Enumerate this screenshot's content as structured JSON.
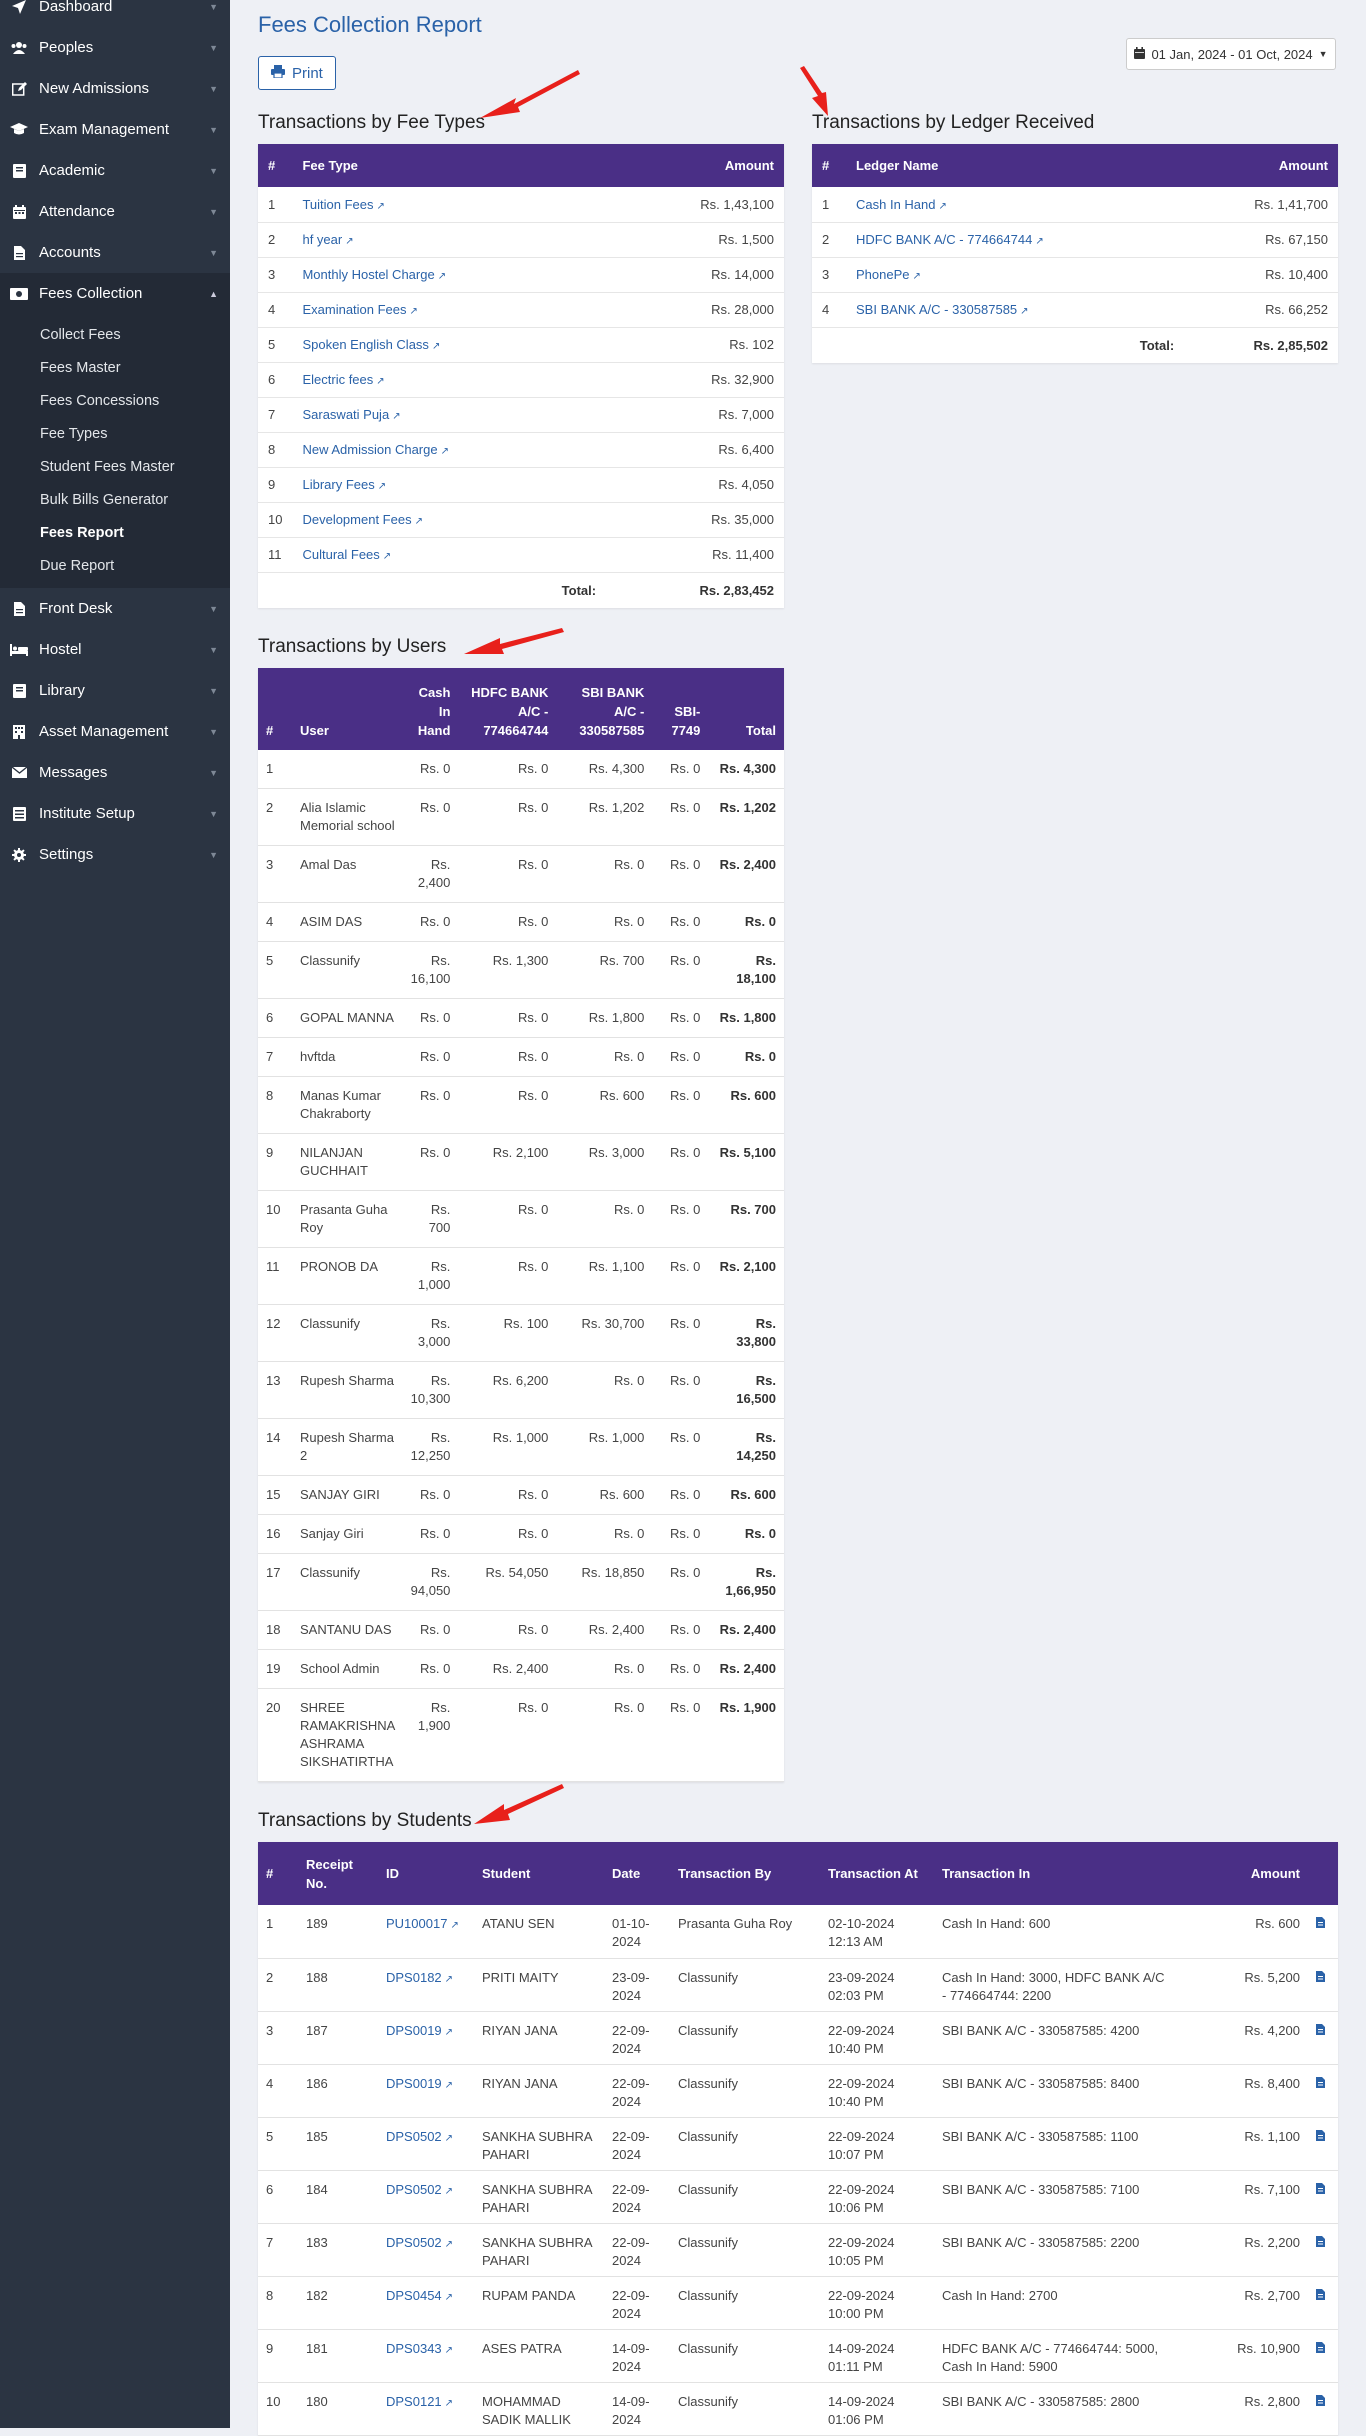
{
  "sidebar": {
    "items": [
      {
        "label": "Dashboard",
        "icon": "location-arrow-icon",
        "key": "dashboard"
      },
      {
        "label": "Peoples",
        "icon": "users-icon",
        "key": "peoples"
      },
      {
        "label": "New Admissions",
        "icon": "edit-icon",
        "key": "new-admissions"
      },
      {
        "label": "Exam Management",
        "icon": "graduation-cap-icon",
        "key": "exam-management"
      },
      {
        "label": "Academic",
        "icon": "book-icon",
        "key": "academic"
      },
      {
        "label": "Attendance",
        "icon": "calendar-icon",
        "key": "attendance"
      },
      {
        "label": "Accounts",
        "icon": "file-icon",
        "key": "accounts"
      },
      {
        "label": "Fees Collection",
        "icon": "money-icon",
        "key": "fees-collection"
      }
    ],
    "sub_items": [
      {
        "label": "Collect Fees"
      },
      {
        "label": "Fees Master"
      },
      {
        "label": "Fees Concessions"
      },
      {
        "label": "Fee Types"
      },
      {
        "label": "Student Fees Master"
      },
      {
        "label": "Bulk Bills Generator"
      },
      {
        "label": "Fees Report"
      },
      {
        "label": "Due Report"
      }
    ],
    "items_after": [
      {
        "label": "Front Desk",
        "icon": "file-icon",
        "key": "front-desk"
      },
      {
        "label": "Hostel",
        "icon": "bed-icon",
        "key": "hostel"
      },
      {
        "label": "Library",
        "icon": "book-icon",
        "key": "library"
      },
      {
        "label": "Asset Management",
        "icon": "building-icon",
        "key": "asset-management"
      },
      {
        "label": "Messages",
        "icon": "envelope-icon",
        "key": "messages"
      },
      {
        "label": "Institute Setup",
        "icon": "server-icon",
        "key": "institute-setup"
      },
      {
        "label": "Settings",
        "icon": "gear-icon",
        "key": "settings"
      }
    ]
  },
  "header": {
    "title": "Fees Collection Report",
    "print_label": "Print",
    "date_range": "01 Jan, 2024 - 01 Oct, 2024"
  },
  "fee_types": {
    "title": "Transactions by Fee Types",
    "headers": {
      "num": "#",
      "name": "Fee Type",
      "amount": "Amount"
    },
    "rows": [
      {
        "num": "1",
        "name": "Tuition Fees",
        "amount": "Rs. 1,43,100"
      },
      {
        "num": "2",
        "name": "hf year",
        "amount": "Rs. 1,500"
      },
      {
        "num": "3",
        "name": "Monthly Hostel Charge",
        "amount": "Rs. 14,000"
      },
      {
        "num": "4",
        "name": "Examination Fees",
        "amount": "Rs. 28,000"
      },
      {
        "num": "5",
        "name": "Spoken English Class",
        "amount": "Rs. 102"
      },
      {
        "num": "6",
        "name": "Electric fees",
        "amount": "Rs. 32,900"
      },
      {
        "num": "7",
        "name": "Saraswati Puja",
        "amount": "Rs. 7,000"
      },
      {
        "num": "8",
        "name": "New Admission Charge",
        "amount": "Rs. 6,400"
      },
      {
        "num": "9",
        "name": "Library Fees",
        "amount": "Rs. 4,050"
      },
      {
        "num": "10",
        "name": "Development Fees",
        "amount": "Rs. 35,000"
      },
      {
        "num": "11",
        "name": "Cultural Fees",
        "amount": "Rs. 11,400"
      }
    ],
    "total_label": "Total:",
    "total_value": "Rs. 2,83,452"
  },
  "ledger": {
    "title": "Transactions by Ledger Received",
    "headers": {
      "num": "#",
      "name": "Ledger Name",
      "amount": "Amount"
    },
    "rows": [
      {
        "num": "1",
        "name": "Cash In Hand",
        "amount": "Rs. 1,41,700"
      },
      {
        "num": "2",
        "name": "HDFC BANK A/C - 774664744",
        "amount": "Rs. 67,150"
      },
      {
        "num": "3",
        "name": "PhonePe",
        "amount": "Rs. 10,400"
      },
      {
        "num": "4",
        "name": "SBI BANK A/C - 330587585",
        "amount": "Rs. 66,252"
      }
    ],
    "total_label": "Total:",
    "total_value": "Rs. 2,85,502"
  },
  "users": {
    "title": "Transactions by Users",
    "headers": {
      "num": "#",
      "user": "User",
      "cash": "Cash In Hand",
      "hdfc": "HDFC BANK A/C - 774664744",
      "sbi": "SBI BANK A/C - 330587585",
      "sbi2": "SBI-7749",
      "total": "Total"
    },
    "rows": [
      {
        "num": "1",
        "user": "",
        "cash": "Rs. 0",
        "hdfc": "Rs. 0",
        "sbi": "Rs. 4,300",
        "sbi2": "Rs. 0",
        "total": "Rs. 4,300"
      },
      {
        "num": "2",
        "user": "Alia Islamic Memorial school",
        "cash": "Rs. 0",
        "hdfc": "Rs. 0",
        "sbi": "Rs. 1,202",
        "sbi2": "Rs. 0",
        "total": "Rs. 1,202"
      },
      {
        "num": "3",
        "user": "Amal Das",
        "cash": "Rs. 2,400",
        "hdfc": "Rs. 0",
        "sbi": "Rs. 0",
        "sbi2": "Rs. 0",
        "total": "Rs. 2,400"
      },
      {
        "num": "4",
        "user": "ASIM DAS",
        "cash": "Rs. 0",
        "hdfc": "Rs. 0",
        "sbi": "Rs. 0",
        "sbi2": "Rs. 0",
        "total": "Rs. 0"
      },
      {
        "num": "5",
        "user": "Classunify",
        "cash": "Rs. 16,100",
        "hdfc": "Rs. 1,300",
        "sbi": "Rs. 700",
        "sbi2": "Rs. 0",
        "total": "Rs. 18,100"
      },
      {
        "num": "6",
        "user": "GOPAL MANNA",
        "cash": "Rs. 0",
        "hdfc": "Rs. 0",
        "sbi": "Rs. 1,800",
        "sbi2": "Rs. 0",
        "total": "Rs. 1,800"
      },
      {
        "num": "7",
        "user": "hvftda",
        "cash": "Rs. 0",
        "hdfc": "Rs. 0",
        "sbi": "Rs. 0",
        "sbi2": "Rs. 0",
        "total": "Rs. 0"
      },
      {
        "num": "8",
        "user": "Manas Kumar Chakraborty",
        "cash": "Rs. 0",
        "hdfc": "Rs. 0",
        "sbi": "Rs. 600",
        "sbi2": "Rs. 0",
        "total": "Rs. 600"
      },
      {
        "num": "9",
        "user": "NILANJAN GUCHHAIT",
        "cash": "Rs. 0",
        "hdfc": "Rs. 2,100",
        "sbi": "Rs. 3,000",
        "sbi2": "Rs. 0",
        "total": "Rs. 5,100"
      },
      {
        "num": "10",
        "user": "Prasanta Guha Roy",
        "cash": "Rs. 700",
        "hdfc": "Rs. 0",
        "sbi": "Rs. 0",
        "sbi2": "Rs. 0",
        "total": "Rs. 700"
      },
      {
        "num": "11",
        "user": "PRONOB DA",
        "cash": "Rs. 1,000",
        "hdfc": "Rs. 0",
        "sbi": "Rs. 1,100",
        "sbi2": "Rs. 0",
        "total": "Rs. 2,100"
      },
      {
        "num": "12",
        "user": "Classunify",
        "cash": "Rs. 3,000",
        "hdfc": "Rs. 100",
        "sbi": "Rs. 30,700",
        "sbi2": "Rs. 0",
        "total": "Rs. 33,800"
      },
      {
        "num": "13",
        "user": "Rupesh Sharma",
        "cash": "Rs. 10,300",
        "hdfc": "Rs. 6,200",
        "sbi": "Rs. 0",
        "sbi2": "Rs. 0",
        "total": "Rs. 16,500"
      },
      {
        "num": "14",
        "user": "Rupesh Sharma 2",
        "cash": "Rs. 12,250",
        "hdfc": "Rs. 1,000",
        "sbi": "Rs. 1,000",
        "sbi2": "Rs. 0",
        "total": "Rs. 14,250"
      },
      {
        "num": "15",
        "user": "SANJAY GIRI",
        "cash": "Rs. 0",
        "hdfc": "Rs. 0",
        "sbi": "Rs. 600",
        "sbi2": "Rs. 0",
        "total": "Rs. 600"
      },
      {
        "num": "16",
        "user": "Sanjay Giri",
        "cash": "Rs. 0",
        "hdfc": "Rs. 0",
        "sbi": "Rs. 0",
        "sbi2": "Rs. 0",
        "total": "Rs. 0"
      },
      {
        "num": "17",
        "user": "Classunify",
        "cash": "Rs. 94,050",
        "hdfc": "Rs. 54,050",
        "sbi": "Rs. 18,850",
        "sbi2": "Rs. 0",
        "total": "Rs. 1,66,950"
      },
      {
        "num": "18",
        "user": "SANTANU DAS",
        "cash": "Rs. 0",
        "hdfc": "Rs. 0",
        "sbi": "Rs. 2,400",
        "sbi2": "Rs. 0",
        "total": "Rs. 2,400"
      },
      {
        "num": "19",
        "user": "School Admin",
        "cash": "Rs. 0",
        "hdfc": "Rs. 2,400",
        "sbi": "Rs. 0",
        "sbi2": "Rs. 0",
        "total": "Rs. 2,400"
      },
      {
        "num": "20",
        "user": "SHREE RAMAKRISHNA ASHRAMA SIKSHATIRTHA",
        "cash": "Rs. 1,900",
        "hdfc": "Rs. 0",
        "sbi": "Rs. 0",
        "sbi2": "Rs. 0",
        "total": "Rs. 1,900"
      }
    ]
  },
  "students": {
    "title": "Transactions by Students",
    "headers": {
      "num": "#",
      "receipt": "Receipt No.",
      "id": "ID",
      "student": "Student",
      "date": "Date",
      "by": "Transaction By",
      "at": "Transaction At",
      "in": "Transaction In",
      "amount": "Amount"
    },
    "rows": [
      {
        "num": "1",
        "receipt": "189",
        "id": "PU100017",
        "student": "ATANU SEN",
        "date": "01-10-2024",
        "by": "Prasanta Guha Roy",
        "at": "02-10-2024 12:13 AM",
        "in": "Cash In Hand: 600",
        "amount": "Rs. 600"
      },
      {
        "num": "2",
        "receipt": "188",
        "id": "DPS0182",
        "student": "PRITI MAITY",
        "date": "23-09-2024",
        "by": "Classunify",
        "at": "23-09-2024 02:03 PM",
        "in": "Cash In Hand: 3000, HDFC BANK A/C - 774664744: 2200",
        "amount": "Rs. 5,200"
      },
      {
        "num": "3",
        "receipt": "187",
        "id": "DPS0019",
        "student": "RIYAN JANA",
        "date": "22-09-2024",
        "by": "Classunify",
        "at": "22-09-2024 10:40 PM",
        "in": "SBI BANK A/C - 330587585: 4200",
        "amount": "Rs. 4,200"
      },
      {
        "num": "4",
        "receipt": "186",
        "id": "DPS0019",
        "student": "RIYAN JANA",
        "date": "22-09-2024",
        "by": "Classunify",
        "at": "22-09-2024 10:40 PM",
        "in": "SBI BANK A/C - 330587585: 8400",
        "amount": "Rs. 8,400"
      },
      {
        "num": "5",
        "receipt": "185",
        "id": "DPS0502",
        "student": "SANKHA SUBHRA PAHARI",
        "date": "22-09-2024",
        "by": "Classunify",
        "at": "22-09-2024 10:07 PM",
        "in": "SBI BANK A/C - 330587585: 1100",
        "amount": "Rs. 1,100"
      },
      {
        "num": "6",
        "receipt": "184",
        "id": "DPS0502",
        "student": "SANKHA SUBHRA PAHARI",
        "date": "22-09-2024",
        "by": "Classunify",
        "at": "22-09-2024 10:06 PM",
        "in": "SBI BANK A/C - 330587585: 7100",
        "amount": "Rs. 7,100"
      },
      {
        "num": "7",
        "receipt": "183",
        "id": "DPS0502",
        "student": "SANKHA SUBHRA PAHARI",
        "date": "22-09-2024",
        "by": "Classunify",
        "at": "22-09-2024 10:05 PM",
        "in": "SBI BANK A/C - 330587585: 2200",
        "amount": "Rs. 2,200"
      },
      {
        "num": "8",
        "receipt": "182",
        "id": "DPS0454",
        "student": "RUPAM PANDA",
        "date": "22-09-2024",
        "by": "Classunify",
        "at": "22-09-2024 10:00 PM",
        "in": "Cash In Hand: 2700",
        "amount": "Rs. 2,700"
      },
      {
        "num": "9",
        "receipt": "181",
        "id": "DPS0343",
        "student": "ASES PATRA",
        "date": "14-09-2024",
        "by": "Classunify",
        "at": "14-09-2024 01:11 PM",
        "in": "HDFC BANK A/C - 774664744: 5000, Cash In Hand: 5900",
        "amount": "Rs. 10,900"
      },
      {
        "num": "10",
        "receipt": "180",
        "id": "DPS0121",
        "student": "MOHAMMAD SADIK MALLIK",
        "date": "14-09-2024",
        "by": "Classunify",
        "at": "14-09-2024 01:06 PM",
        "in": "SBI BANK A/C - 330587585: 2800",
        "amount": "Rs. 2,800"
      }
    ]
  },
  "colors": {
    "header_purple": "#4a2f86",
    "link_blue": "#2a62a8",
    "sidebar_bg": "#2b3442",
    "arrow_red": "#e8201b"
  }
}
